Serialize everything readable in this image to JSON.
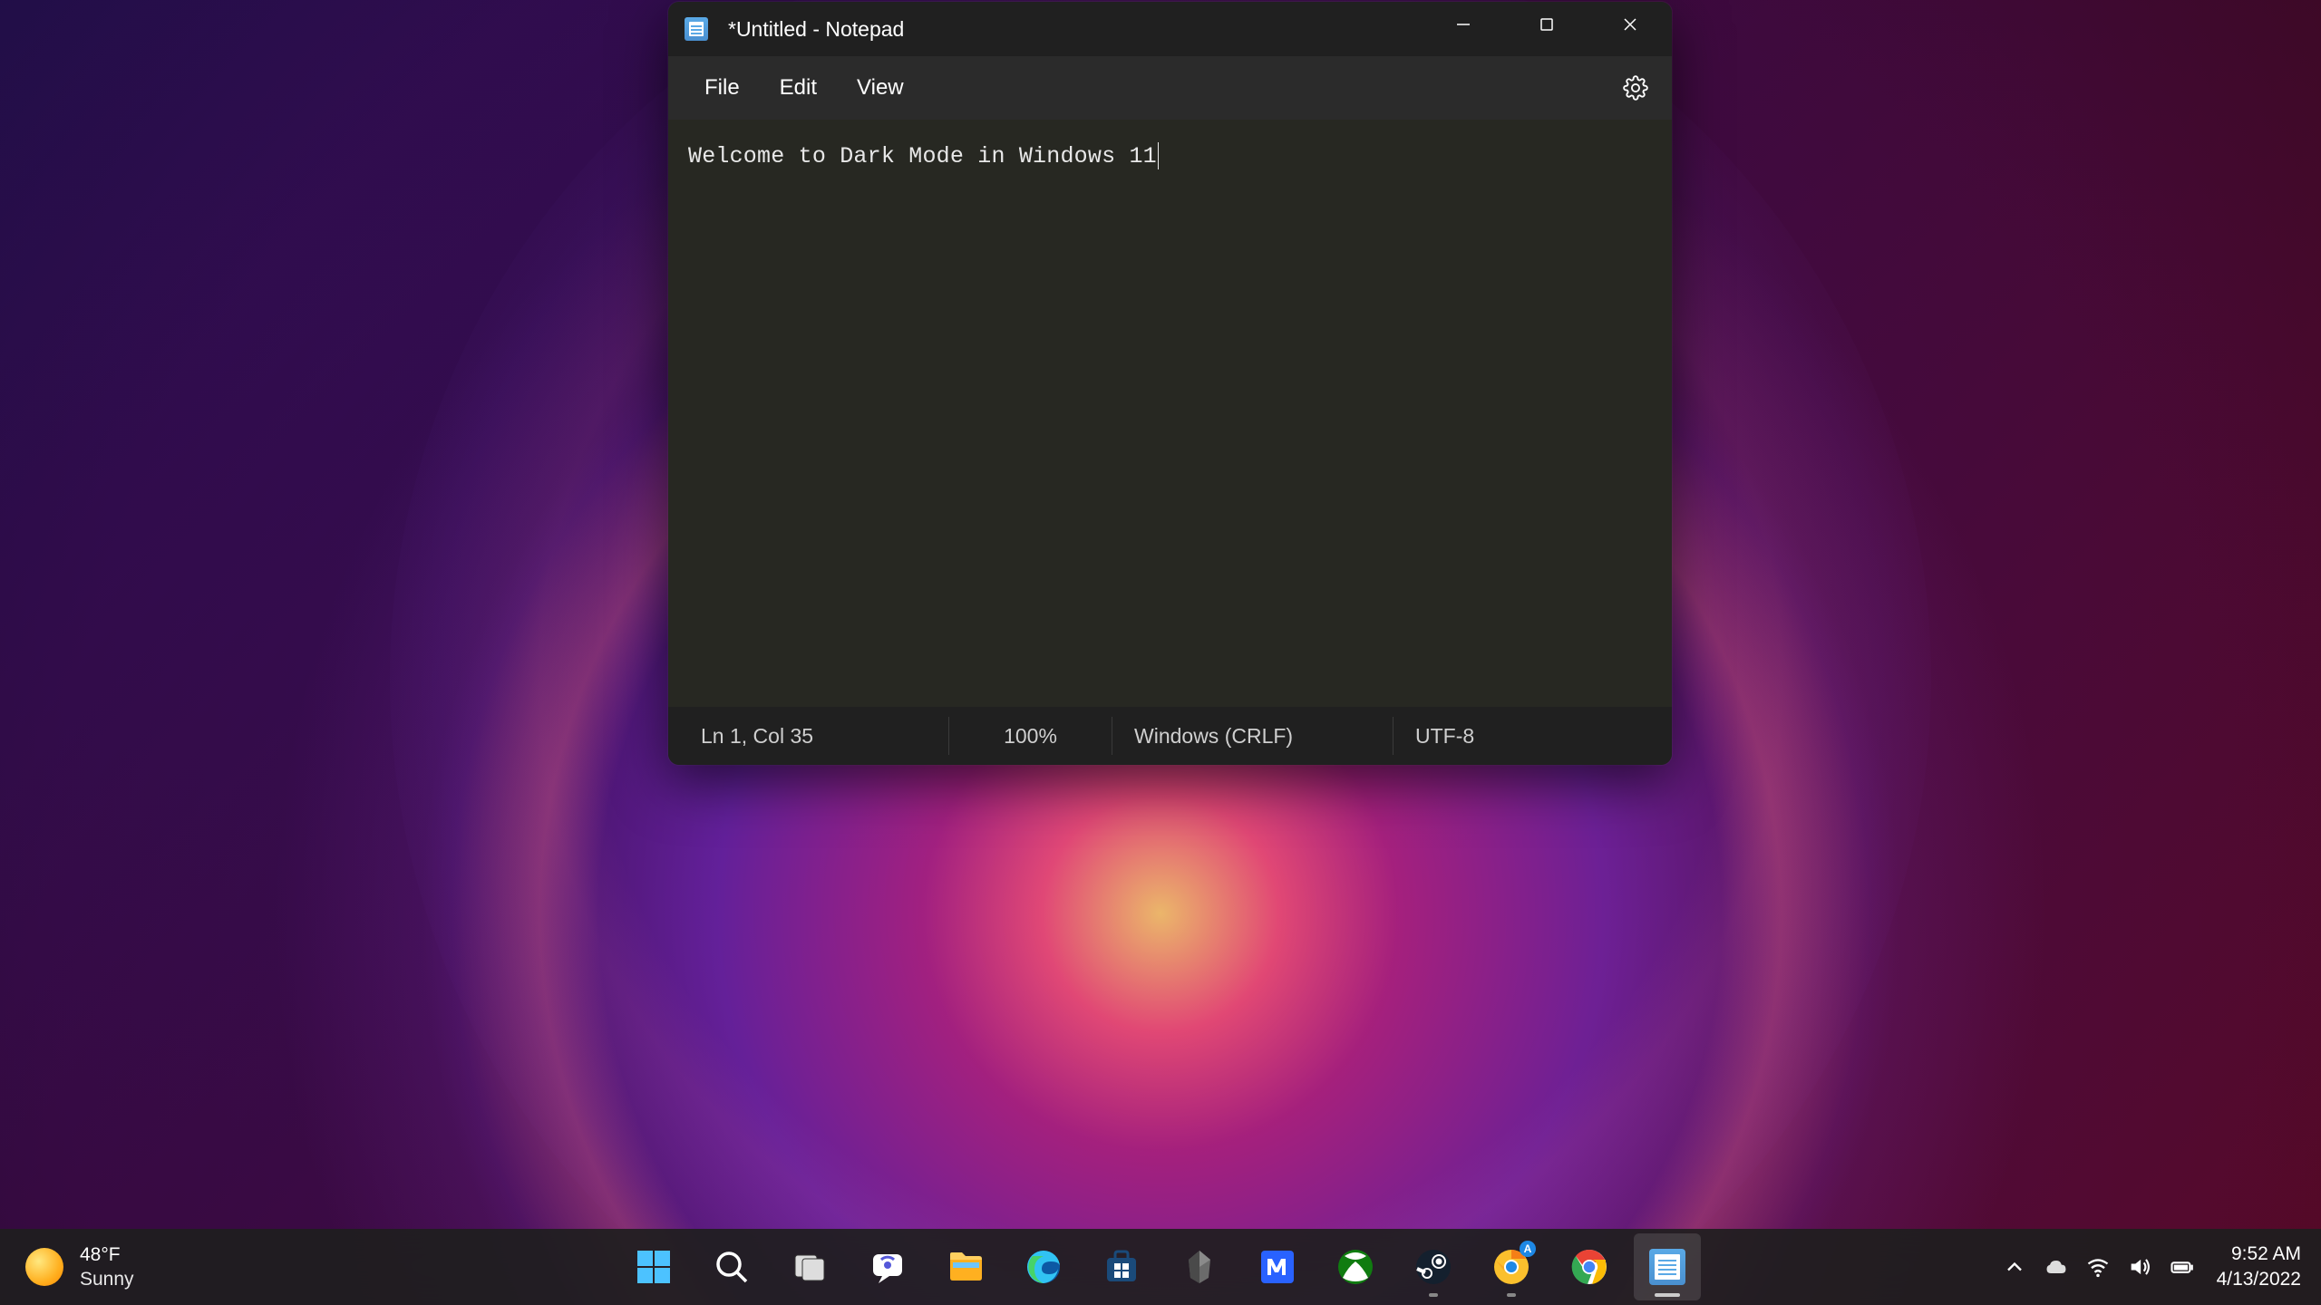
{
  "notepad": {
    "title": "*Untitled - Notepad",
    "menu": {
      "file": "File",
      "edit": "Edit",
      "view": "View"
    },
    "content": "Welcome to Dark Mode in Windows 11",
    "status": {
      "cursor": "Ln 1, Col 35",
      "zoom": "100%",
      "line_ending": "Windows (CRLF)",
      "encoding": "UTF-8"
    }
  },
  "taskbar": {
    "weather": {
      "temp": "48°F",
      "condition": "Sunny"
    },
    "apps": [
      {
        "name": "start",
        "label": "Start"
      },
      {
        "name": "search",
        "label": "Search"
      },
      {
        "name": "task-view",
        "label": "Task View"
      },
      {
        "name": "chat",
        "label": "Chat"
      },
      {
        "name": "file-explorer",
        "label": "File Explorer"
      },
      {
        "name": "edge",
        "label": "Microsoft Edge"
      },
      {
        "name": "store",
        "label": "Microsoft Store"
      },
      {
        "name": "obsidian",
        "label": "Obsidian"
      },
      {
        "name": "m-app",
        "label": "M App"
      },
      {
        "name": "xbox",
        "label": "Xbox"
      },
      {
        "name": "steam",
        "label": "Steam"
      },
      {
        "name": "chrome-canary",
        "label": "Chrome Canary"
      },
      {
        "name": "chrome",
        "label": "Google Chrome"
      },
      {
        "name": "notepad",
        "label": "Notepad"
      }
    ],
    "clock": {
      "time": "9:52 AM",
      "date": "4/13/2022"
    }
  }
}
